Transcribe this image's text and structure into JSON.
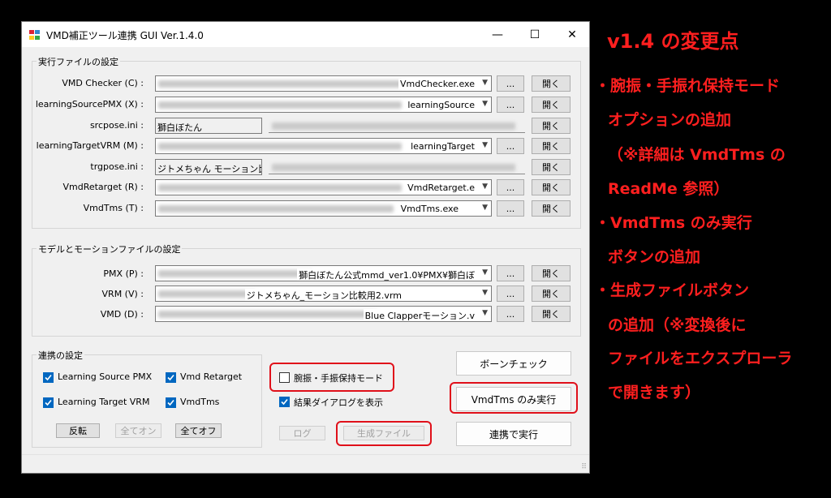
{
  "window": {
    "title": "VMD補正ツール連携 GUI Ver.1.4.0",
    "minimize": "—",
    "maximize": "☐",
    "close": "✕"
  },
  "exec_group": {
    "title": "実行ファイルの設定",
    "rows": [
      {
        "label": "VMD Checker (C) :",
        "value": "VmdChecker.exe",
        "browse": "...",
        "open": "開く"
      },
      {
        "label": "learningSourcePMX (X) :",
        "value": "learningSource",
        "browse": "...",
        "open": "開く"
      },
      {
        "label": "srcpose.ini :",
        "value": "獅白ぼたん",
        "open": "開く"
      },
      {
        "label": "learningTargetVRM (M) :",
        "value": "learningTarget",
        "browse": "...",
        "open": "開く"
      },
      {
        "label": "trgpose.ini :",
        "value": "ジトメちゃん モーション比較用",
        "open": "開く"
      },
      {
        "label": "VmdRetarget (R) :",
        "value": "VmdRetarget.e",
        "browse": "...",
        "open": "開く"
      },
      {
        "label": "VmdTms (T) :",
        "value": "VmdTms.exe",
        "browse": "...",
        "open": "開く"
      }
    ]
  },
  "model_group": {
    "title": "モデルとモーションファイルの設定",
    "rows": [
      {
        "label": "PMX (P) :",
        "value": "獅白ぼたん公式mmd_ver1.0¥PMX¥獅白ぼ",
        "browse": "...",
        "open": "開く"
      },
      {
        "label": "VRM (V) :",
        "value": "ジトメちゃん_モーション比較用2.vrm",
        "browse": "...",
        "open": "開く"
      },
      {
        "label": "VMD (D) :",
        "value": "Blue Clapperモーション.v",
        "browse": "...",
        "open": "開く"
      }
    ]
  },
  "link_group": {
    "title": "連携の設定",
    "checks": [
      {
        "label": "Learning Source PMX",
        "checked": true
      },
      {
        "label": "Vmd Retarget",
        "checked": true
      },
      {
        "label": "Learning Target VRM",
        "checked": true
      },
      {
        "label": "VmdTms",
        "checked": true
      }
    ],
    "invert": "反転",
    "all_on": "全てオン",
    "all_off": "全てオフ"
  },
  "options": {
    "arm_keep": "腕振・手振保持モード",
    "show_result": "結果ダイアログを表示",
    "log": "ログ",
    "generated_files": "生成ファイル"
  },
  "actions": {
    "bone_check": "ボーンチェック",
    "vmdtms_only": "VmdTms のみ実行",
    "run_linked": "連携で実行"
  },
  "notes": {
    "heading": "v1.4 の変更点",
    "lines": [
      "・腕振・手振れ保持モード",
      "オプションの追加",
      "（※詳細は VmdTms の",
      "ReadMe 参照）",
      "・VmdTms のみ実行",
      "ボタンの追加",
      "・生成ファイルボタン",
      "の追加（※変換後に",
      "ファイルをエクスプローラ",
      "で開きます）"
    ]
  },
  "colors": {
    "accent": "#0067c0",
    "highlight": "#e0101a",
    "note": "#ff1f1f"
  }
}
